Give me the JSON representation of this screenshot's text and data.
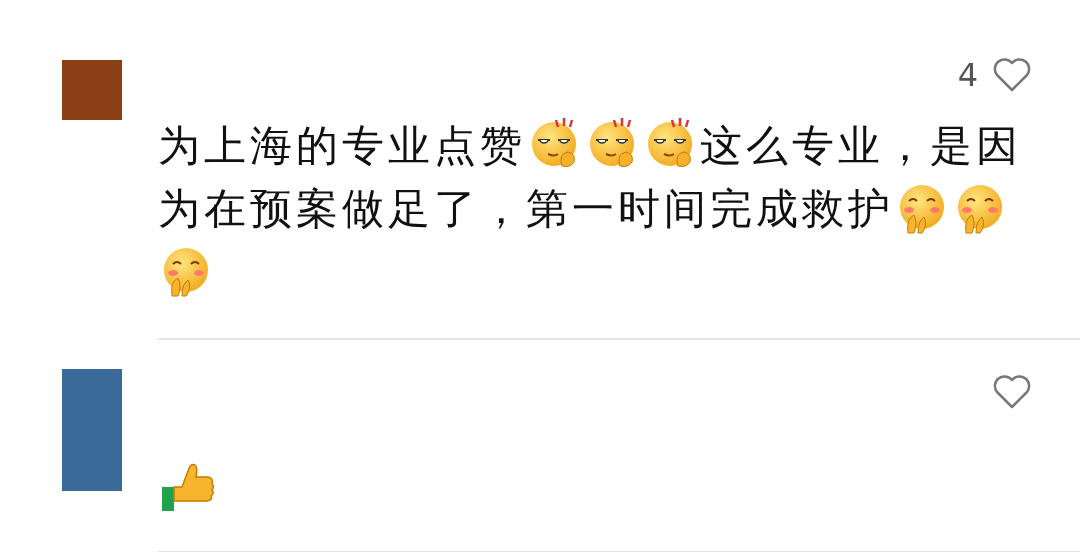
{
  "comments": [
    {
      "color": "#8c3f15",
      "likes": "4",
      "content": [
        {
          "kind": "text",
          "text": "为上海的专业点赞"
        },
        {
          "kind": "smug"
        },
        {
          "kind": "smug"
        },
        {
          "kind": "smug"
        },
        {
          "kind": "text",
          "text": "这么专业，是因"
        },
        {
          "kind": "text",
          "text": "为在预案做足了，第一时间完成救护"
        },
        {
          "kind": "shy"
        },
        {
          "kind": "shy"
        },
        {
          "kind": "shy"
        }
      ]
    },
    {
      "color": "#3a6a9a",
      "content": [
        {
          "kind": "thumbs"
        }
      ]
    }
  ]
}
